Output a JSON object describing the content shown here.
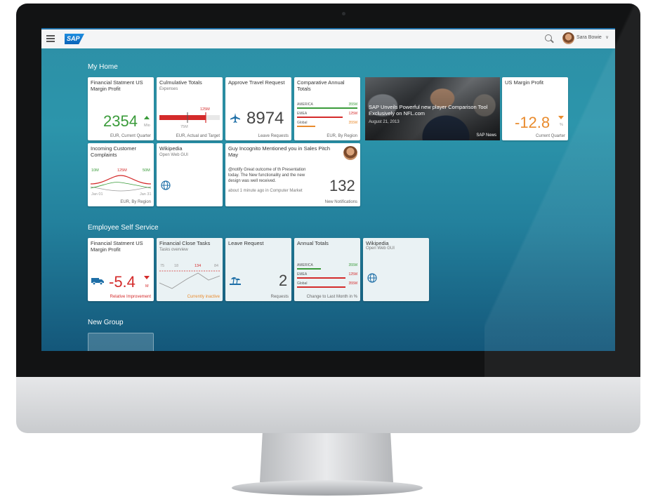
{
  "shell": {
    "user_name": "Sara Bowie",
    "chevron": "∨"
  },
  "groups": {
    "my_home": "My Home",
    "ess": "Employee Self Service",
    "new_group": "New Group"
  },
  "tiles": {
    "fin_statement": {
      "title": "Financial Statment US Margin Profit",
      "value": "2354",
      "unit": "Mio",
      "footer": "EUR, Current Quarter"
    },
    "cumulative": {
      "title": "Culmulative Totals",
      "subtitle": "Expenses",
      "mark_top": "125M",
      "mark_bottom": "75M",
      "footer": "EUR, Actual and Target"
    },
    "approve_travel": {
      "title": "Approve Travel Request",
      "value": "8974",
      "footer": "Leave Requests"
    },
    "comparative": {
      "title": "Comparative Annual Totals",
      "rows": [
        {
          "label": "AMERICA",
          "value": "355M"
        },
        {
          "label": "EMEA",
          "value": "125M"
        },
        {
          "label": "Global",
          "value": "355M"
        }
      ],
      "footer": "EUR, By Region"
    },
    "news": {
      "headline": "SAP Unveils Powerful new player Comparison Tool Exclusively on NFL.com",
      "date": "August 21, 2013",
      "source": "SAP News"
    },
    "us_margin": {
      "title": "US Margin Profit",
      "value": "-12.8",
      "unit": "%",
      "footer": "Current Quarter"
    },
    "complaints": {
      "title": "Incoming Customer Complaints",
      "v1": "10M",
      "v2": "125M",
      "v3": "50M",
      "x1": "Jan 01",
      "x2": "Jan 31",
      "footer": "EUR, By Region"
    },
    "wikipedia": {
      "title": "Wikipedia",
      "subtitle": "Open Web GUI"
    },
    "notification": {
      "title": "Guy Incognito Mentioned you in Sales Pitch May",
      "body": "@notify Great outcome of th Presentation today. The New functionality and the new design was well received.",
      "time": "about 1 minute ago in Computer Market",
      "value": "132",
      "footer": "New Notifications"
    },
    "ess_fin": {
      "title": "Financial Statment US Margin Profit",
      "value": "-5.4",
      "unit": "M",
      "footer": "Relative Improvement"
    },
    "close_tasks": {
      "title": "Financial Close Tasks",
      "subtitle": "Tasks overview",
      "n1": "75",
      "n2": "18",
      "n3": "134",
      "n4": "84",
      "footer": "Currently inactive"
    },
    "leave": {
      "title": "Leave Request",
      "value": "2",
      "footer": "Requests"
    },
    "annual": {
      "title": "Annual Totals",
      "rows": [
        {
          "label": "AMERICA",
          "value": "355M"
        },
        {
          "label": "EMEA",
          "value": "125M"
        },
        {
          "label": "Global",
          "value": "355M"
        }
      ],
      "footer": "Change to Last Month in %"
    },
    "ess_wiki": {
      "title": "Wikipedia",
      "subtitle": "Open Web GUI"
    }
  },
  "colors": {
    "green": "#3a9b3a",
    "red": "#d42b2b",
    "orange": "#e98b2d",
    "brand": "#1e6fa7"
  }
}
